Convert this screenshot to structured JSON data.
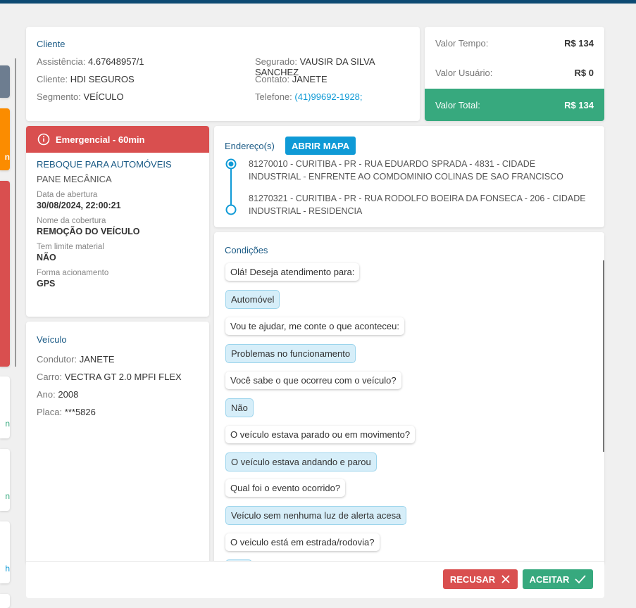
{
  "cliente": {
    "title": "Cliente",
    "assistencia_label": "Assistência:",
    "assistencia": "4.67648957/1",
    "cliente_label": "Cliente:",
    "cliente": "HDI SEGUROS",
    "segmento_label": "Segmento:",
    "segmento": "VEÍCULO",
    "segurado_label": "Segurado:",
    "segurado": "VAUSIR DA SILVA SANCHEZ",
    "contato_label": "Contato:",
    "contato": "JANETE",
    "telefone_label": "Telefone:",
    "telefone": "(41)99692-1928;"
  },
  "valores": {
    "tempo_label": "Valor Tempo:",
    "tempo": "R$ 134",
    "usuario_label": "Valor Usuário:",
    "usuario": "R$ 0",
    "total_label": "Valor Total:",
    "total": "R$ 134"
  },
  "servico": {
    "badge": "Emergencial - 60min",
    "tipo": "REBOQUE PARA AUTOMÓVEIS",
    "motivo": "PANE MECÂNICA",
    "data_label": "Data de abertura",
    "data": "30/08/2024, 22:00:21",
    "cobertura_label": "Nome da cobertura",
    "cobertura": "REMOÇÃO DO VEÍCULO",
    "limite_label": "Tem limite material",
    "limite": "NÃO",
    "forma_label": "Forma acionamento",
    "forma": "GPS"
  },
  "veiculo": {
    "title": "Veículo",
    "condutor_label": "Condutor:",
    "condutor": "JANETE",
    "carro_label": "Carro:",
    "carro": "VECTRA GT 2.0 MPFI FLEX",
    "ano_label": "Ano:",
    "ano": "2008",
    "placa_label": "Placa:",
    "placa": "***5826"
  },
  "enderecos": {
    "title": "Endereço(s)",
    "map_button": "ABRIR MAPA",
    "items": [
      "81270010 - CURITIBA - PR - RUA EDUARDO SPRADA - 4831 - CIDADE INDUSTRIAL - ENFRENTE AO COMDOMINIO COLINAS DE SAO FRANCISCO",
      "81270321 - CURITIBA - PR - RUA RODOLFO BOEIRA DA FONSECA - 206 - CIDADE INDUSTRIAL - RESIDENCIA"
    ]
  },
  "condicoes": {
    "title": "Condições",
    "messages": [
      "Olá! Deseja atendimento para:",
      "Automóvel",
      "Vou te ajudar, me conte o que aconteceu:",
      "Problemas no funcionamento",
      "Você sabe o que ocorreu com o veículo?",
      "Não",
      "O veículo estava parado ou em movimento?",
      "O veículo estava andando e parou",
      "Qual foi o evento ocorrido?",
      "Veículo sem nenhuma luz de alerta acesa",
      "O veiculo está em estrada/rodovia?"
    ]
  },
  "footer": {
    "recusar": "RECUSAR",
    "aceitar": "ACEITAR"
  },
  "side": {
    "labels": [
      "n",
      "n",
      "n",
      "h"
    ]
  },
  "colors": {
    "accent": "#0f9ad6",
    "green": "#37a97e",
    "red": "#d94f4f",
    "orange": "#fb8c00"
  }
}
